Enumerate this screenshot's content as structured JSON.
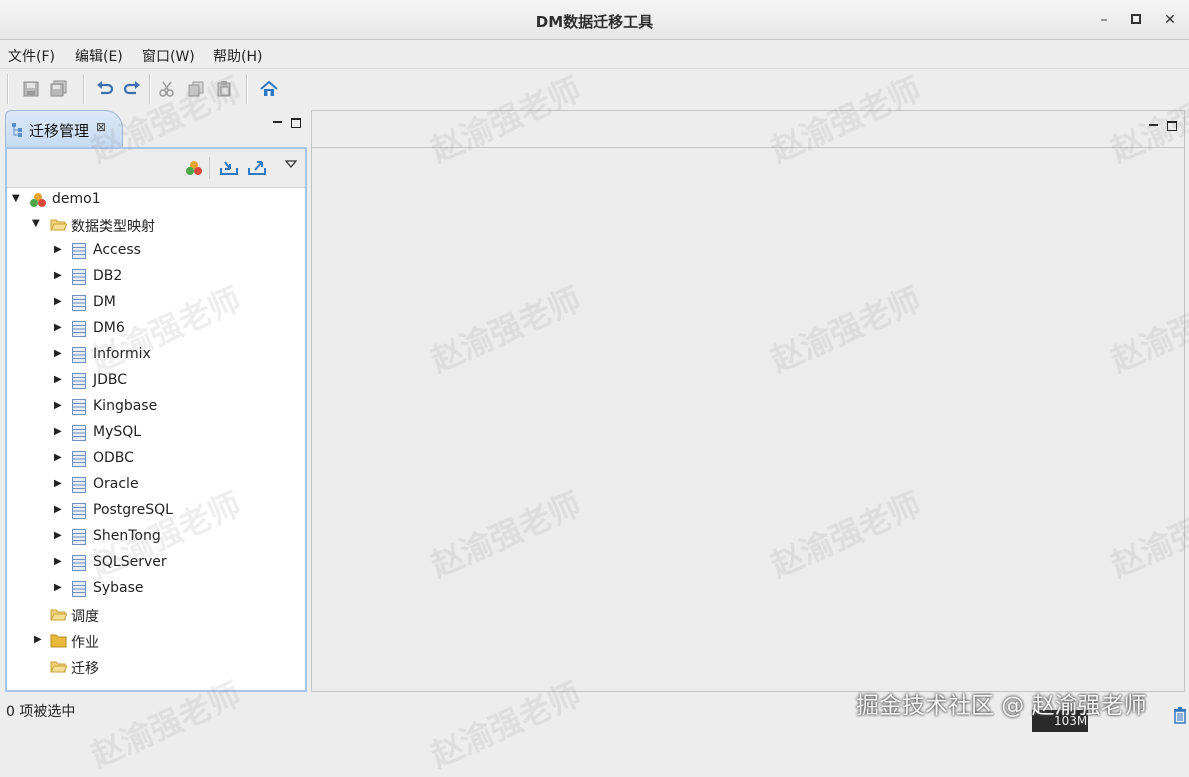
{
  "window": {
    "title": "DM数据迁移工具"
  },
  "menu": {
    "items": [
      {
        "label": "文件(F)"
      },
      {
        "label": "编辑(E)"
      },
      {
        "label": "窗口(W)"
      },
      {
        "label": "帮助(H)"
      }
    ]
  },
  "left_panel": {
    "tab_label": "迁移管理",
    "close_glyph": "⊠"
  },
  "tree": {
    "root": "demo1",
    "mapping_folder": "数据类型映射",
    "mappings": [
      "Access",
      "DB2",
      "DM",
      "DM6",
      "Informix",
      "JDBC",
      "Kingbase",
      "MySQL",
      "ODBC",
      "Oracle",
      "PostgreSQL",
      "ShenTong",
      "SQLServer",
      "Sybase"
    ],
    "schedule": "调度",
    "jobs": "作业",
    "migrate": "迁移"
  },
  "status": {
    "selection": "0 项被选中",
    "memory": "103M"
  },
  "watermark": {
    "text": "赵渝强老师",
    "signature": "掘金技术社区 @ 赵渝强老师"
  },
  "colors": {
    "accent": "#a8c4e6",
    "folder": "#e8b83a",
    "home": "#2f78c4"
  }
}
